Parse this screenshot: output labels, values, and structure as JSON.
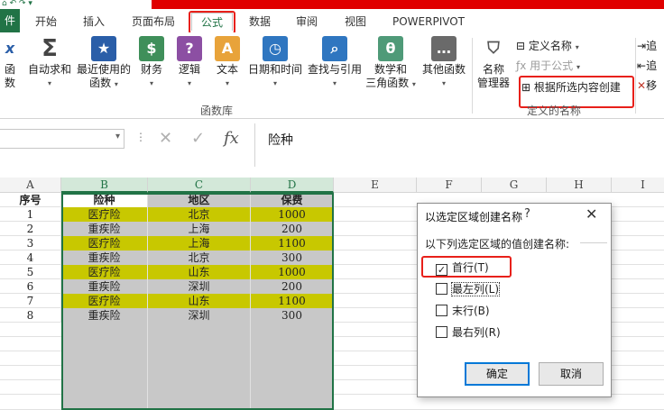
{
  "tabs": [
    {
      "label": "件",
      "left": 0
    },
    {
      "label": "开始"
    },
    {
      "label": "插入"
    },
    {
      "label": "页面布局"
    },
    {
      "label": "公式"
    },
    {
      "label": "数据"
    },
    {
      "label": "审阅"
    },
    {
      "label": "视图"
    },
    {
      "label": "POWERPIVOT"
    }
  ],
  "ribbon": {
    "btn_partial_left": "函数",
    "btn_autosum": "自动求和",
    "btn_recent_1": "最近使用的",
    "btn_recent_2": "函数",
    "btn_finance": "财务",
    "btn_logic": "逻辑",
    "btn_text": "文本",
    "btn_datetime": "日期和时间",
    "btn_lookup": "查找与引用",
    "btn_math_1": "数学和",
    "btn_math_2": "三角函数",
    "btn_other": "其他函数",
    "group_library": "函数库",
    "btn_name_mgr_1": "名称",
    "btn_name_mgr_2": "管理器",
    "define_name": "定义名称",
    "use_in_formula": "用于公式",
    "create_from_selection": "根据所选内容创建",
    "group_defined_names": "定义的名称",
    "right_1": "追",
    "right_2": "追",
    "right_3": "移"
  },
  "formula_bar": {
    "content": "险种",
    "fx": "fx"
  },
  "columns": [
    "A",
    "B",
    "C",
    "D",
    "E",
    "F",
    "G",
    "H",
    "I"
  ],
  "table": {
    "header": [
      "序号",
      "险种",
      "地区",
      "保费"
    ],
    "rows": [
      [
        "1",
        "医疗险",
        "北京",
        "1000"
      ],
      [
        "2",
        "重疾险",
        "上海",
        "200"
      ],
      [
        "3",
        "医疗险",
        "上海",
        "1100"
      ],
      [
        "4",
        "重疾险",
        "北京",
        "300"
      ],
      [
        "5",
        "医疗险",
        "山东",
        "1000"
      ],
      [
        "6",
        "重疾险",
        "深圳",
        "200"
      ],
      [
        "7",
        "医疗险",
        "山东",
        "1100"
      ],
      [
        "8",
        "重疾险",
        "深圳",
        "300"
      ]
    ]
  },
  "dialog": {
    "title": "以选定区域创建名称",
    "help": "?",
    "close": "✕",
    "prompt": "以下列选定区域的值创建名称:",
    "options": [
      {
        "label": "首行(T)",
        "checked": true
      },
      {
        "label": "最左列(L)",
        "checked": false
      },
      {
        "label": "末行(B)",
        "checked": false
      },
      {
        "label": "最右列(R)",
        "checked": false
      }
    ],
    "ok": "确定",
    "cancel": "取消"
  },
  "colors": {
    "accent": "#217346",
    "highlight_red": "#e8201a",
    "row_yellow": "#c8c800",
    "row_gray": "#c8c8c8"
  }
}
